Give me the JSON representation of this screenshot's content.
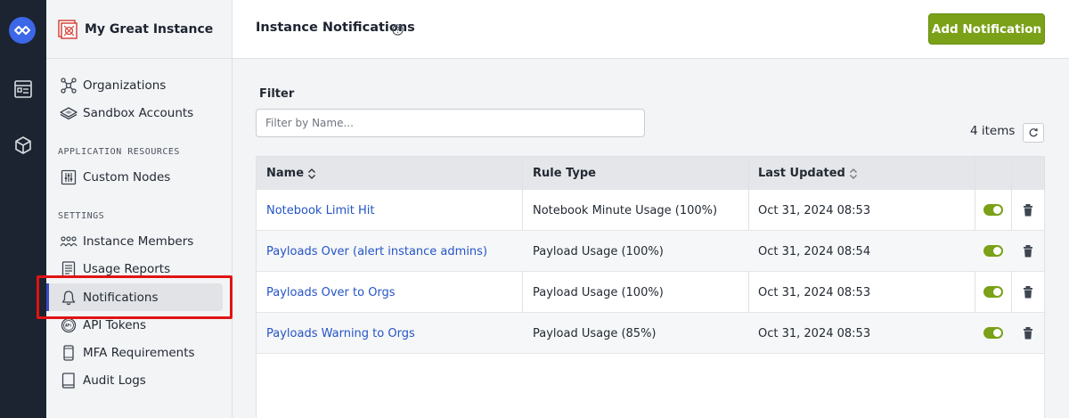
{
  "instance": {
    "name": "My Great Instance"
  },
  "nav": {
    "items_top": [
      {
        "label": "Organizations",
        "icon": "organizations-icon"
      },
      {
        "label": "Sandbox Accounts",
        "icon": "sandbox-icon"
      }
    ],
    "section_app": "APPLICATION RESOURCES",
    "items_app": [
      {
        "label": "Custom Nodes",
        "icon": "custom-nodes-icon"
      }
    ],
    "section_settings": "SETTINGS",
    "items_settings": [
      {
        "label": "Instance Members",
        "icon": "members-icon"
      },
      {
        "label": "Usage Reports",
        "icon": "report-icon"
      },
      {
        "label": "Notifications",
        "icon": "bell-icon",
        "active": true
      },
      {
        "label": "API Tokens",
        "icon": "api-token-icon"
      },
      {
        "label": "MFA Requirements",
        "icon": "phone-icon"
      },
      {
        "label": "Audit Logs",
        "icon": "book-icon"
      }
    ]
  },
  "header": {
    "title": "Instance Notifications",
    "add_button": "Add Notification"
  },
  "filter": {
    "label": "Filter",
    "placeholder": "Filter by Name...",
    "items_count": "4 items"
  },
  "table": {
    "columns": [
      "Name",
      "Rule Type",
      "Last Updated"
    ],
    "rows": [
      {
        "name": "Notebook Limit Hit",
        "rule_type": "Notebook Minute Usage (100%)",
        "last_updated": "Oct 31, 2024 08:53",
        "enabled": true
      },
      {
        "name": "Payloads Over (alert instance admins)",
        "rule_type": "Payload Usage (100%)",
        "last_updated": "Oct 31, 2024 08:54",
        "enabled": true
      },
      {
        "name": "Payloads Over to Orgs",
        "rule_type": "Payload Usage (100%)",
        "last_updated": "Oct 31, 2024 08:53",
        "enabled": true
      },
      {
        "name": "Payloads Warning to Orgs",
        "rule_type": "Payload Usage (85%)",
        "last_updated": "Oct 31, 2024 08:53",
        "enabled": true
      }
    ]
  },
  "colors": {
    "accent_green": "#7aa117",
    "link_blue": "#2454c7",
    "rail_bg": "#1b2430",
    "highlight_red": "#e01414"
  }
}
